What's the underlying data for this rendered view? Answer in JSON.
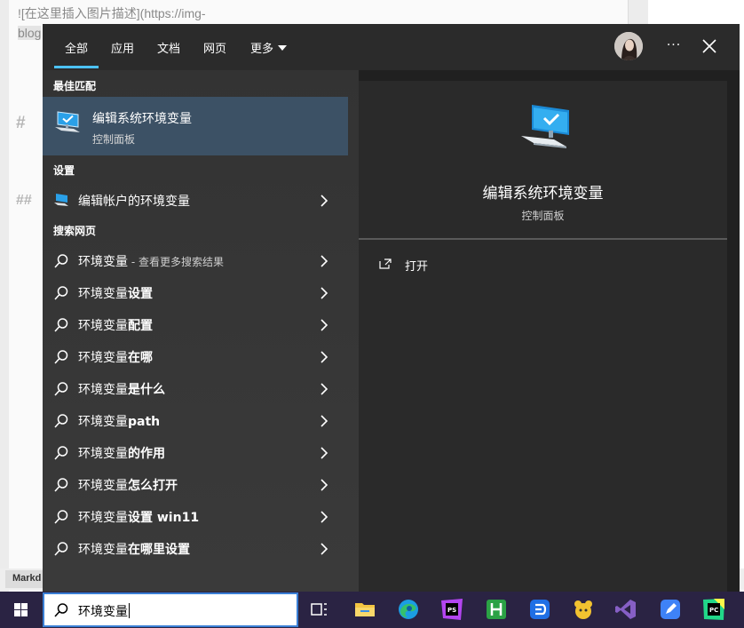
{
  "background_editor": {
    "text_line1": "![在这里插入图片描述](https://img-",
    "text_line2": "blog",
    "heading1_prefix": "#",
    "heading2_prefix": "##",
    "status_label": "Markd"
  },
  "search_panel": {
    "tabs": [
      {
        "label": "全部",
        "active": true
      },
      {
        "label": "应用"
      },
      {
        "label": "文档"
      },
      {
        "label": "网页"
      },
      {
        "label": "更多"
      }
    ],
    "more_button_label": "···",
    "sections": {
      "best_match": "最佳匹配",
      "settings": "设置",
      "web_search": "搜索网页"
    },
    "best_match": {
      "title": "编辑系统环境变量",
      "subtitle": "控制面板"
    },
    "settings_items": [
      {
        "label": "编辑帐户的环境变量"
      }
    ],
    "web_results": [
      {
        "label": "环境变量",
        "hint": " - 查看更多搜索结果"
      },
      {
        "query": "环境变量",
        "suffix": "设置"
      },
      {
        "query": "环境变量",
        "suffix": "配置"
      },
      {
        "query": "环境变量",
        "suffix": "在哪"
      },
      {
        "query": "环境变量",
        "suffix": "是什么"
      },
      {
        "query": "环境变量",
        "suffix": "path"
      },
      {
        "query": "环境变量",
        "suffix": "的作用"
      },
      {
        "query": "环境变量",
        "suffix": "怎么打开"
      },
      {
        "query": "环境变量",
        "suffix": "设置 win11"
      },
      {
        "query": "环境变量",
        "suffix": "在哪里设置"
      }
    ],
    "preview": {
      "title": "编辑系统环境变量",
      "subtitle": "控制面板",
      "actions": [
        {
          "label": "打开"
        }
      ]
    }
  },
  "taskbar": {
    "search_value": "环境变量",
    "pinned_icons": [
      "task-view-icon",
      "file-explorer-icon",
      "edge-icon",
      "phpstorm-icon",
      "hbuilder-icon",
      "dingtalk-icon",
      "app-icon",
      "visual-studio-icon",
      "notes-app-icon",
      "pycharm-icon"
    ]
  },
  "colors": {
    "accent": "#4cc2ff",
    "panel_bg": "#202020",
    "left_column_bg": "#333333",
    "best_match_highlight": "#3c5165",
    "taskbar_bg": "#2a2343"
  }
}
